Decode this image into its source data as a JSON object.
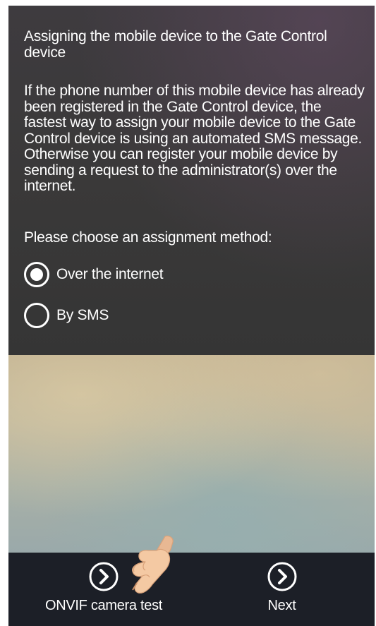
{
  "content": {
    "heading": "Assigning the mobile device to the Gate Control device",
    "description": "If the phone number of this mobile device has already been registered in the Gate Control device, the fastest way to assign your mobile device to the Gate Control device is using an automated SMS message. Otherwise you can register your mobile device by sending a request to the administrator(s) over the internet.",
    "prompt": "Please choose an assignment method:"
  },
  "assignment_methods": [
    {
      "label": "Over the internet",
      "selected": true
    },
    {
      "label": "By SMS",
      "selected": false
    }
  ],
  "bottom_bar": {
    "onvif_label": "ONVIF camera test",
    "onvif_icon": "chevron-right-circle-icon",
    "next_label": "Next",
    "next_icon": "chevron-right-circle-icon"
  },
  "colors": {
    "panel_background": "#3a3939",
    "bottom_bar_background": "#1c1f27",
    "text": "#ffffff"
  }
}
